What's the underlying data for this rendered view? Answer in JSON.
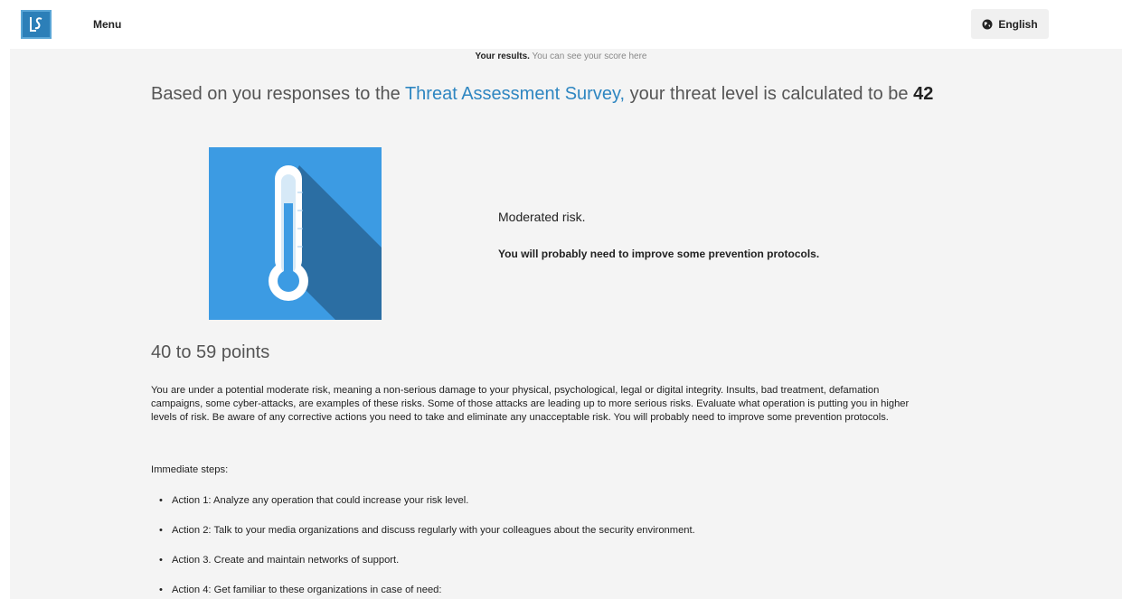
{
  "header": {
    "logo_text": "LS",
    "menu_label": "Menu",
    "language_label": "English",
    "language_icon": "globe-icon",
    "logo_color": "#2c7fb8"
  },
  "results": {
    "title": "Your results.",
    "subtitle": "You can see your score here"
  },
  "headline": {
    "prefix": "Based on you responses to the",
    "survey_link": "Threat Assessment Survey,",
    "middle": "your threat level is calculated to be",
    "score": "42"
  },
  "risk": {
    "icon": "thermometer-icon",
    "tile_color": "#3c9be3",
    "title": "Moderated risk.",
    "subtitle": "You will probably need to improve some prevention protocols."
  },
  "points_range": "40 to 59 points",
  "description": "You are under a potential moderate risk, meaning a non-serious damage to your physical, psychological, legal or digital integrity. Insults, bad treatment, defamation campaigns, some cyber-attacks, are examples of these risks. Some of those attacks are leading up to more serious risks. Evaluate what operation is putting you in higher levels of risk. Be aware of any corrective actions you need to take and eliminate any unacceptable risk. You will probably need to improve some prevention protocols.",
  "steps_label": "Immediate steps:",
  "actions": [
    "Action 1: Analyze any operation that could increase your risk level.",
    "Action 2: Talk to your media organizations and discuss regularly with your colleagues about the security environment.",
    "Action 3. Create and maintain networks of support.",
    "Action 4: Get familiar to these organizations in case of need:"
  ]
}
